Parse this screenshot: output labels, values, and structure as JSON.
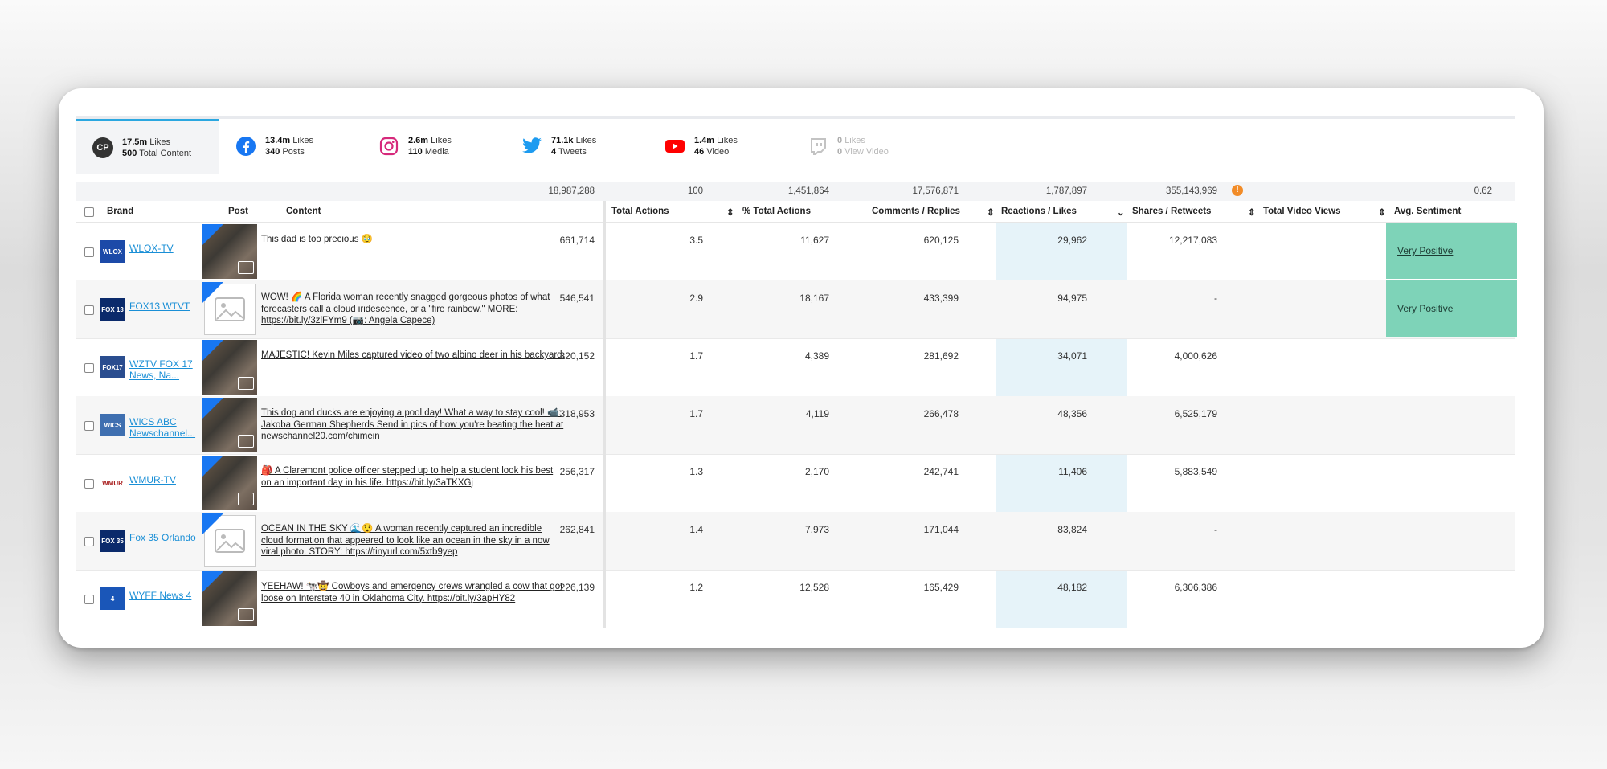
{
  "tabs": [
    {
      "icon": "cp-logo",
      "badge": "CP",
      "v1": "17.5m",
      "l1": "Likes",
      "v2": "500",
      "l2": "Total Content",
      "active": true
    },
    {
      "icon": "facebook-icon",
      "v1": "13.4m",
      "l1": "Likes",
      "v2": "340",
      "l2": "Posts"
    },
    {
      "icon": "instagram-icon",
      "v1": "2.6m",
      "l1": "Likes",
      "v2": "110",
      "l2": "Media"
    },
    {
      "icon": "twitter-icon",
      "v1": "71.1k",
      "l1": "Likes",
      "v2": "4",
      "l2": "Tweets"
    },
    {
      "icon": "youtube-icon",
      "v1": "1.4m",
      "l1": "Likes",
      "v2": "46",
      "l2": "Video"
    },
    {
      "icon": "twitch-icon",
      "v1": "0",
      "l1": "Likes",
      "v2": "0",
      "l2": "View Video",
      "dim": true
    }
  ],
  "totals": {
    "total_actions": "18,987,288",
    "pct_total": "100",
    "comments": "1,451,864",
    "reactions": "17,576,871",
    "shares": "1,787,897",
    "video_views": "355,143,969",
    "sentiment": "0.62"
  },
  "headers": {
    "brand": "Brand",
    "post": "Post",
    "content": "Content",
    "total_actions": "Total Actions",
    "pct_total": "% Total Actions",
    "comments": "Comments / Replies",
    "reactions": "Reactions / Likes",
    "shares": "Shares / Retweets",
    "video_views": "Total Video Views",
    "sentiment": "Avg. Sentiment"
  },
  "rows": [
    {
      "brand": "WLOX-TV",
      "logo_color": "#1c4aa8",
      "logo_text": "WLOX",
      "thumb": "photo",
      "content": "This dad is too precious 🥹",
      "total": "661,714",
      "pct": "3.5",
      "comments": "11,627",
      "reactions": "620,125",
      "shares": "29,962",
      "views": "12,217,083",
      "sentiment": "Very Positive"
    },
    {
      "brand": "FOX13 WTVT",
      "logo_color": "#0b2a6b",
      "logo_text": "FOX 13",
      "thumb": "placeholder",
      "content": "WOW! 🌈 A Florida woman recently snagged gorgeous photos of what forecasters call a cloud iridescence, or a \"fire rainbow.\" MORE: https://bit.ly/3zlFYm9 (📷: Angela Capece)",
      "total": "546,541",
      "pct": "2.9",
      "comments": "18,167",
      "reactions": "433,399",
      "shares": "94,975",
      "views": "-",
      "sentiment": "Very Positive"
    },
    {
      "brand": "WZTV FOX 17 News, Na...",
      "logo_color": "#2a4d8f",
      "logo_text": "FOX17",
      "thumb": "photo",
      "content": "MAJESTIC! Kevin Miles captured video of two albino deer in his backyard.",
      "total": "320,152",
      "pct": "1.7",
      "comments": "4,389",
      "reactions": "281,692",
      "shares": "34,071",
      "views": "4,000,626",
      "sentiment": ""
    },
    {
      "brand": "WICS ABC Newschannel...",
      "logo_color": "#3f6fb0",
      "logo_text": "WICS",
      "thumb": "photo",
      "content": "This dog and ducks are enjoying a pool day! What a way to stay cool! 📹: Jakoba German Shepherds Send in pics of how you're beating the heat at newschannel20.com/chimein",
      "total": "318,953",
      "pct": "1.7",
      "comments": "4,119",
      "reactions": "266,478",
      "shares": "48,356",
      "views": "6,525,179",
      "sentiment": ""
    },
    {
      "brand": "WMUR-TV",
      "logo_color": "#ffffff",
      "logo_text": "WMUR",
      "thumb": "photo",
      "content": "🎒 A Claremont police officer stepped up to help a student look his best on an important day in his life. https://bit.ly/3aTKXGj",
      "total": "256,317",
      "pct": "1.3",
      "comments": "2,170",
      "reactions": "242,741",
      "shares": "11,406",
      "views": "5,883,549",
      "sentiment": ""
    },
    {
      "brand": "Fox 35 Orlando",
      "logo_color": "#0b2a6b",
      "logo_text": "FOX 35",
      "thumb": "placeholder",
      "content": "OCEAN IN THE SKY 🌊😯 A woman recently captured an incredible cloud formation that appeared to look like an ocean in the sky in a now viral photo. STORY: https://tinyurl.com/5xtb9yep",
      "total": "262,841",
      "pct": "1.4",
      "comments": "7,973",
      "reactions": "171,044",
      "shares": "83,824",
      "views": "-",
      "sentiment": ""
    },
    {
      "brand": "WYFF News 4",
      "logo_color": "#1a56b8",
      "logo_text": "4",
      "thumb": "photo",
      "content": "YEEHAW! 🐄🤠 Cowboys and emergency crews wrangled a cow that got loose on Interstate 40 in Oklahoma City. https://bit.ly/3apHY82",
      "total": "226,139",
      "pct": "1.2",
      "comments": "12,528",
      "reactions": "165,429",
      "shares": "48,182",
      "views": "6,306,386",
      "sentiment": ""
    }
  ],
  "colors": {
    "accent": "#2aa7e0",
    "link": "#1a8fd6",
    "sentiment_bg": "#7ed3b8",
    "highlight_col": "#e6f3f9",
    "warning": "#f28c28"
  }
}
